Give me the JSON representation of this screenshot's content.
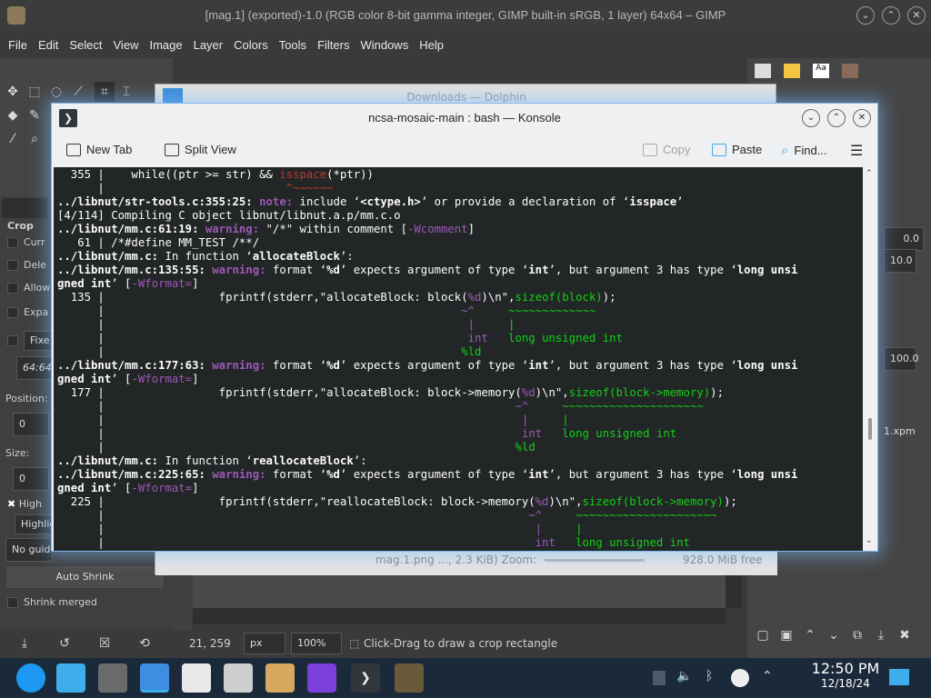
{
  "gimp": {
    "title": "[mag.1] (exported)-1.0 (RGB color 8-bit gamma integer, GIMP built-in sRGB, 1 layer) 64x64 – GIMP",
    "menu": [
      "File",
      "Edit",
      "Select",
      "View",
      "Image",
      "Layer",
      "Colors",
      "Tools",
      "Filters",
      "Windows",
      "Help"
    ],
    "tool_options": {
      "title": "Crop",
      "checks": [
        "Curr",
        "Dele",
        "Allow",
        "Expa",
        "Fixe"
      ],
      "aspect": "64:64",
      "position_label": "Position:",
      "position_value": "0",
      "size_label": "Size:",
      "size_value": "0",
      "highlight_label": "High",
      "highlight_opacity": "Highlig",
      "guides": "No guid",
      "auto_shrink": "Auto Shrink",
      "shrink_merged": "Shrink merged"
    },
    "right_dock": {
      "value1": "0.0",
      "value2": "10.0",
      "value3": "100.0",
      "file_label": "1.xpm"
    },
    "status": {
      "coords": "21, 259",
      "unit": "px",
      "zoom": "100%",
      "message": "Click-Drag to draw a crop rectangle"
    }
  },
  "dolphin": {
    "title": "Downloads — Dolphin",
    "status_text": "mag.1.png ..., 2.3 KiB) Zoom:",
    "free_space": "928.0 MiB free"
  },
  "konsole": {
    "title": "ncsa-mosaic-main : bash — Konsole",
    "toolbar": {
      "new_tab": "New Tab",
      "split_view": "Split View",
      "copy": "Copy",
      "paste": "Paste",
      "find": "Find..."
    }
  },
  "taskbar": {
    "time": "12:50 PM",
    "date": "12/18/24"
  },
  "colors": {
    "konsole_bg": "#232627",
    "warning": "#9b59b6",
    "note": "#9b59b6",
    "path": "#2980b9",
    "fixit": "#11d116",
    "error_flag": "#c0392b"
  }
}
